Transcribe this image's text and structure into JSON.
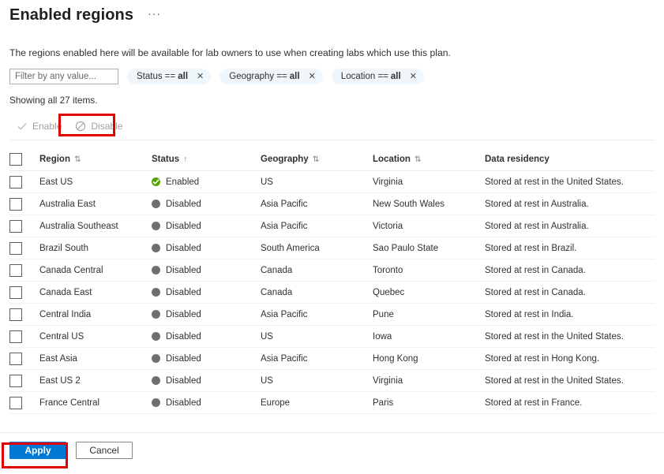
{
  "header": {
    "title": "Enabled regions",
    "ellipsis": "···"
  },
  "description": "The regions enabled here will be available for lab owners to use when creating labs which use this plan.",
  "filters": {
    "search_placeholder": "Filter by any value...",
    "search_value": "",
    "chips": [
      {
        "label": "Status ==",
        "value": "all",
        "close": "✕"
      },
      {
        "label": "Geography ==",
        "value": "all",
        "close": "✕"
      },
      {
        "label": "Location ==",
        "value": "all",
        "close": "✕"
      }
    ]
  },
  "showing_text": "Showing all 27 items.",
  "command_bar": {
    "enable_label": "Enable",
    "disable_label": "Disable"
  },
  "table": {
    "columns": [
      {
        "label": "Region",
        "sort": "⇅"
      },
      {
        "label": "Status",
        "sort": "↑"
      },
      {
        "label": "Geography",
        "sort": "⇅"
      },
      {
        "label": "Location",
        "sort": "⇅"
      },
      {
        "label": "Data residency",
        "sort": ""
      }
    ],
    "rows": [
      {
        "region": "East US",
        "status": "Enabled",
        "state": "enabled",
        "geography": "US",
        "location": "Virginia",
        "residency": "Stored at rest in the United States."
      },
      {
        "region": "Australia East",
        "status": "Disabled",
        "state": "disabled",
        "geography": "Asia Pacific",
        "location": "New South Wales",
        "residency": "Stored at rest in Australia."
      },
      {
        "region": "Australia Southeast",
        "status": "Disabled",
        "state": "disabled",
        "geography": "Asia Pacific",
        "location": "Victoria",
        "residency": "Stored at rest in Australia."
      },
      {
        "region": "Brazil South",
        "status": "Disabled",
        "state": "disabled",
        "geography": "South America",
        "location": "Sao Paulo State",
        "residency": "Stored at rest in Brazil."
      },
      {
        "region": "Canada Central",
        "status": "Disabled",
        "state": "disabled",
        "geography": "Canada",
        "location": "Toronto",
        "residency": "Stored at rest in Canada."
      },
      {
        "region": "Canada East",
        "status": "Disabled",
        "state": "disabled",
        "geography": "Canada",
        "location": "Quebec",
        "residency": "Stored at rest in Canada."
      },
      {
        "region": "Central India",
        "status": "Disabled",
        "state": "disabled",
        "geography": "Asia Pacific",
        "location": "Pune",
        "residency": "Stored at rest in India."
      },
      {
        "region": "Central US",
        "status": "Disabled",
        "state": "disabled",
        "geography": "US",
        "location": "Iowa",
        "residency": "Stored at rest in the United States."
      },
      {
        "region": "East Asia",
        "status": "Disabled",
        "state": "disabled",
        "geography": "Asia Pacific",
        "location": "Hong Kong",
        "residency": "Stored at rest in Hong Kong."
      },
      {
        "region": "East US 2",
        "status": "Disabled",
        "state": "disabled",
        "geography": "US",
        "location": "Virginia",
        "residency": "Stored at rest in the United States."
      },
      {
        "region": "France Central",
        "status": "Disabled",
        "state": "disabled",
        "geography": "Europe",
        "location": "Paris",
        "residency": "Stored at rest in France."
      }
    ]
  },
  "footer": {
    "apply_label": "Apply",
    "cancel_label": "Cancel"
  },
  "colors": {
    "primary": "#0078d4",
    "enabled_green": "#57a300",
    "disabled_gray": "#6e6e6e",
    "chip_bg": "#eff6fc",
    "annotation_red": "#e00000"
  }
}
